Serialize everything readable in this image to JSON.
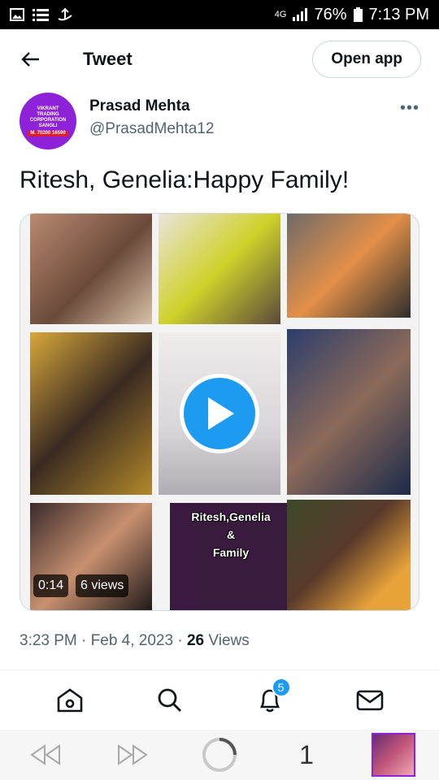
{
  "status_bar": {
    "network": "4G",
    "battery": "76%",
    "time": "7:13 PM"
  },
  "header": {
    "title": "Tweet",
    "open_app": "Open app"
  },
  "author": {
    "name": "Prasad Mehta",
    "handle": "@PrasadMehta12",
    "avatar_text": [
      "VIKRANT",
      "TRADING",
      "CORPORATION",
      "SANGLI",
      "M. 70200 16590"
    ]
  },
  "tweet": {
    "text": "Ritesh, Genelia:Happy Family!"
  },
  "media": {
    "caption_lines": [
      "Ritesh,Genelia",
      "&",
      "Family"
    ],
    "duration": "0:14",
    "views": "6 views"
  },
  "meta": {
    "time": "3:23 PM",
    "date": "Feb 4, 2023",
    "views_count": "26",
    "views_label": "Views"
  },
  "tabbar": {
    "notifications_badge": "5"
  },
  "browser_nav": {
    "tab_count": "1"
  },
  "colors": {
    "accent": "#1d9bf0",
    "avatar": "#8e22d8",
    "text": "#0f1419",
    "muted": "#536471"
  }
}
